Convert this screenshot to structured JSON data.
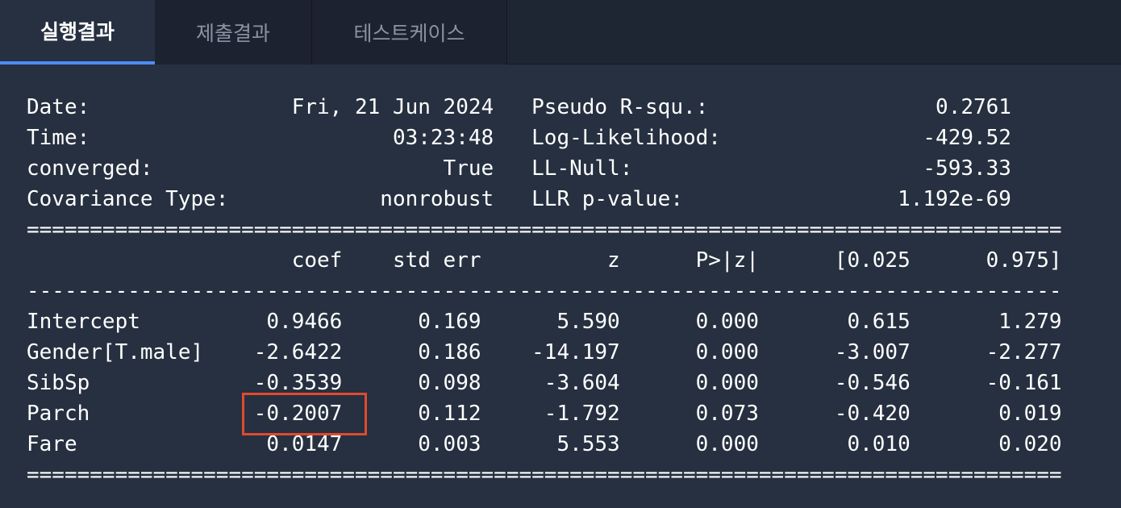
{
  "tabs": [
    {
      "label": "실행결과",
      "active": true
    },
    {
      "label": "제출결과",
      "active": false
    },
    {
      "label": "테스트케이스",
      "active": false
    }
  ],
  "output": {
    "lines": [
      "Date:                Fri, 21 Jun 2024   Pseudo R-squ.:                  0.2761",
      "Time:                        03:23:48   Log-Likelihood:                -429.52",
      "converged:                       True   LL-Null:                       -593.33",
      "Covariance Type:            nonrobust   LLR p-value:                 1.192e-69",
      "==================================================================================",
      "                     coef    std err          z      P>|z|      [0.025      0.975]",
      "----------------------------------------------------------------------------------",
      "Intercept          0.9466      0.169      5.590      0.000       0.615       1.279",
      "Gender[T.male]    -2.6422      0.186    -14.197      0.000      -3.007      -2.277",
      "SibSp             -0.3539      0.098     -3.604      0.000      -0.546      -0.161",
      "Parch             -0.2007      0.112     -1.792      0.073      -0.420       0.019",
      "Fare               0.0147      0.003      5.553      0.000       0.010       0.020",
      "=================================================================================="
    ],
    "highlight_color": "#e04a2e"
  },
  "colors": {
    "background": "#263040",
    "tabbar": "#1f2633",
    "active_tab_indicator": "#4f8df5",
    "inactive_tab_text": "#8a93a3"
  }
}
